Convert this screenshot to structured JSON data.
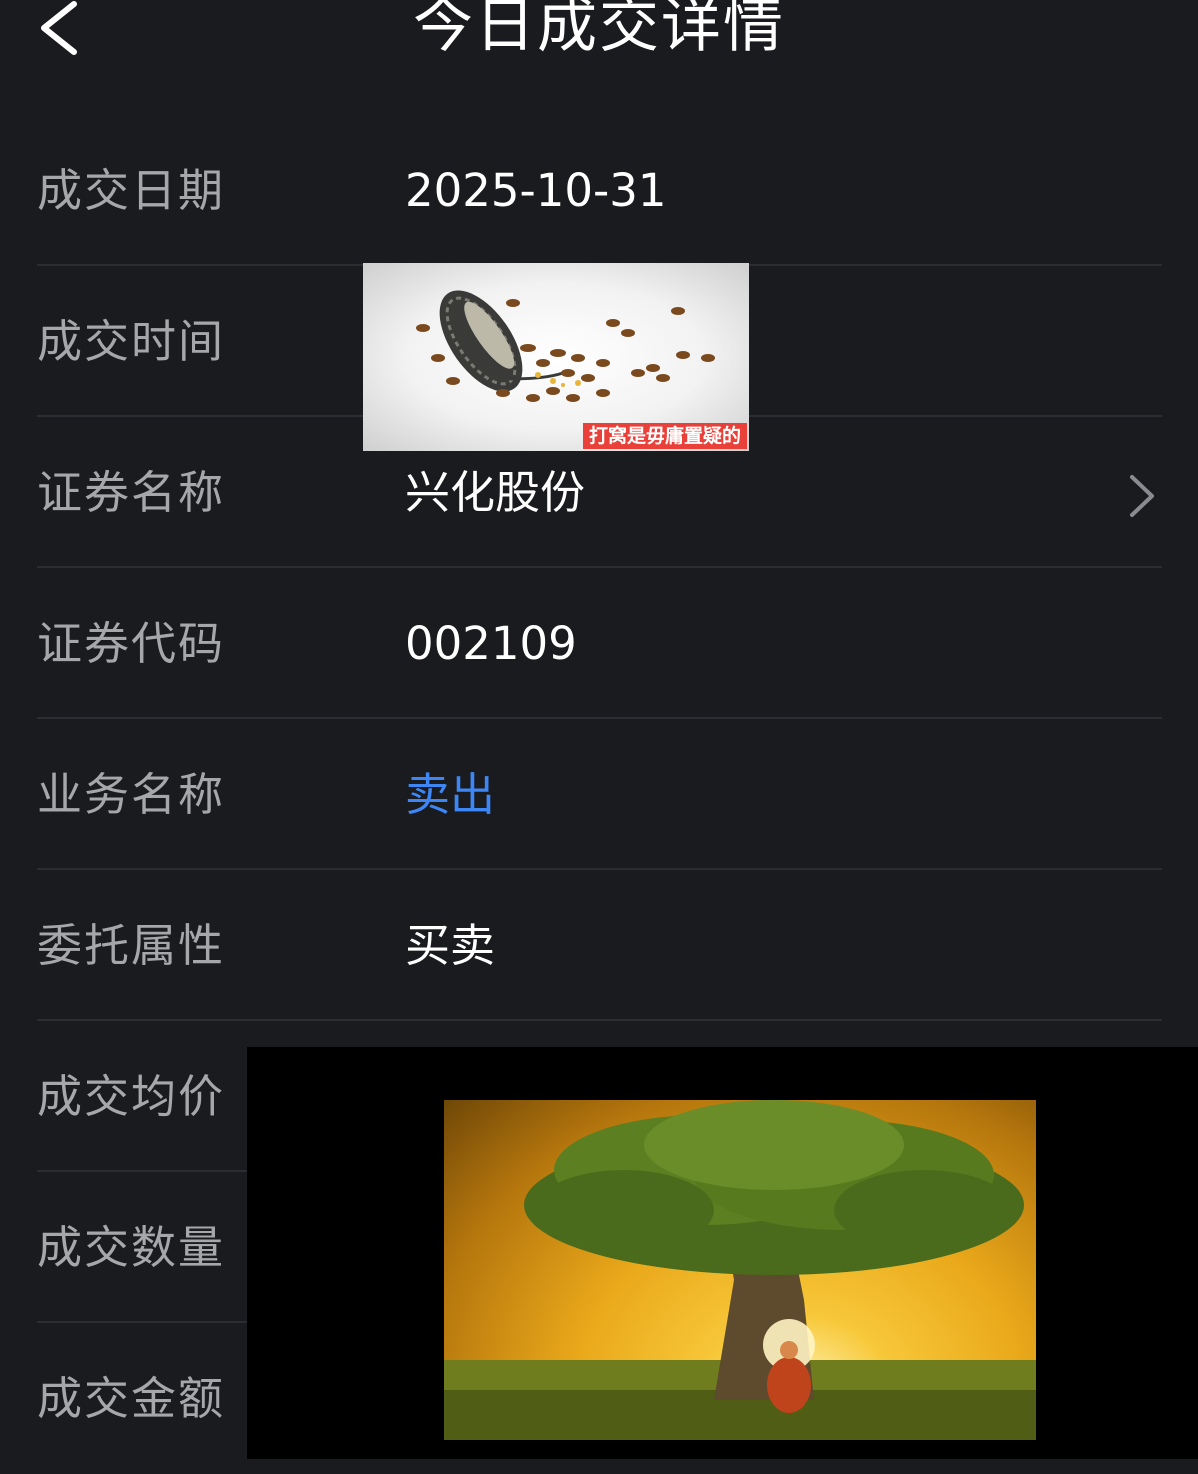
{
  "header": {
    "title": "今日成交详情",
    "back_icon": "chevron-left-icon"
  },
  "rows": [
    {
      "label": "成交日期",
      "value": "2025-10-31"
    },
    {
      "label": "成交时间",
      "value": ""
    },
    {
      "label": "证券名称",
      "value": "兴化股份",
      "trailing_icon": "chevron-right-icon"
    },
    {
      "label": "证券代码",
      "value": "002109"
    },
    {
      "label": "业务名称",
      "value": "卖出",
      "value_color": "#3d86f5"
    },
    {
      "label": "委托属性",
      "value": "买卖"
    },
    {
      "label": "成交均价",
      "value": ""
    },
    {
      "label": "成交数量",
      "value": ""
    },
    {
      "label": "成交金额",
      "value": ""
    }
  ],
  "overlays": {
    "sparrows_image": {
      "caption": "打窝是毋庸置疑的"
    },
    "tree_image": {
      "subtitle": ""
    }
  },
  "colors": {
    "background": "#1a1b1f",
    "label": "#a6a7ab",
    "value": "#ffffff",
    "accent_blue": "#3d86f5",
    "separator": "#2c2d32"
  }
}
